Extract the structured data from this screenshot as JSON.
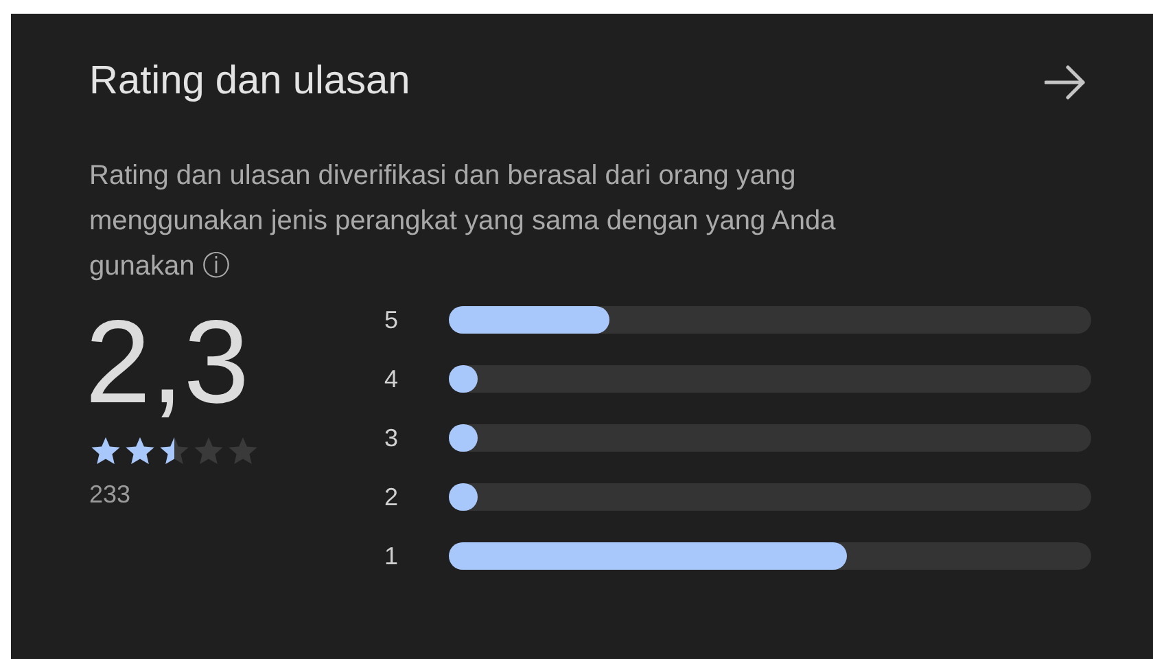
{
  "section": {
    "title": "Rating dan ulasan",
    "description": "Rating dan ulasan diverifikasi dan berasal dari orang yang menggunakan jenis perangkat yang sama dengan yang Anda gunakan ⓘ"
  },
  "summary": {
    "score": "2,3",
    "stars": 2.5,
    "count": "233"
  },
  "distribution": [
    {
      "label": "5",
      "level": 0.25
    },
    {
      "label": "4",
      "level": 0.045
    },
    {
      "label": "3",
      "level": 0.045
    },
    {
      "label": "2",
      "level": 0.045
    },
    {
      "label": "1",
      "level": 0.62
    }
  ]
}
